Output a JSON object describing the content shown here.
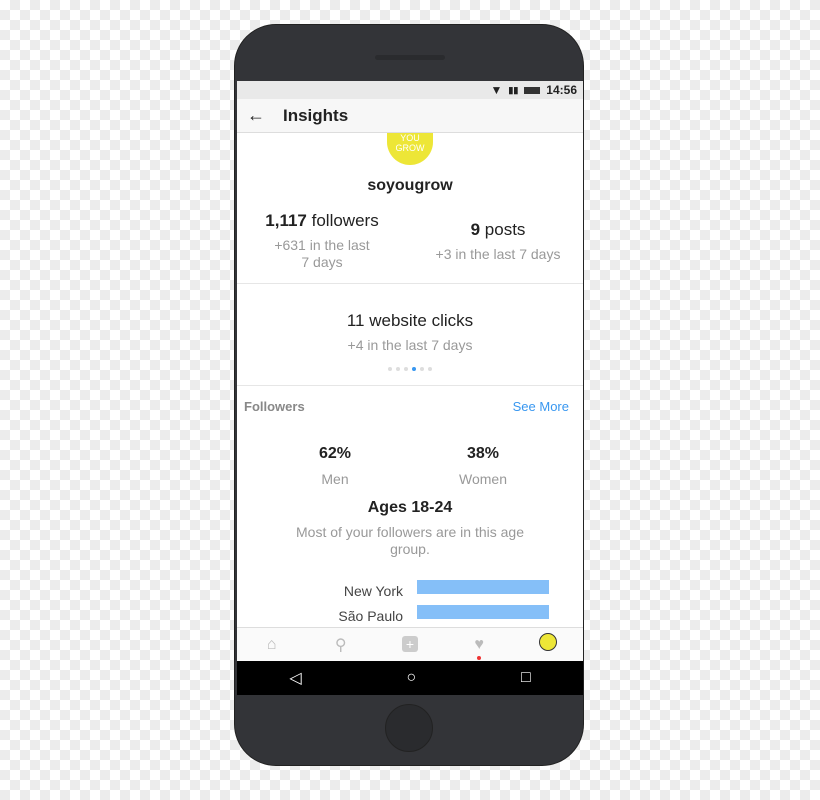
{
  "status": {
    "time": "14:56",
    "wifi_icon": "wifi-icon",
    "signal_icon": "signal-icon",
    "battery_icon": "battery-icon"
  },
  "appbar": {
    "back": "←",
    "title": "Insights"
  },
  "profile": {
    "avatar_text": "YOU GROW",
    "username": "soyougrow"
  },
  "stats": {
    "followers": {
      "value": "1,117",
      "label": "followers",
      "delta": "+631 in the last 7 days"
    },
    "posts": {
      "value": "9",
      "label": "posts",
      "delta": "+3 in the last 7 days"
    },
    "clicks": {
      "title": "11 website clicks",
      "delta": "+4 in the last 7 days"
    }
  },
  "carousel": {
    "count": 6,
    "active": 4
  },
  "followers_section": {
    "title": "Followers",
    "see_more": "See More",
    "men": {
      "pct": "62%",
      "label": "Men"
    },
    "women": {
      "pct": "38%",
      "label": "Women"
    },
    "ages": "Ages 18-24",
    "ages_sub": "Most of your followers are in this age group.",
    "cities": [
      {
        "name": "New York",
        "share": 1.0
      },
      {
        "name": "São Paulo",
        "share": 1.0
      }
    ]
  },
  "colors": {
    "accent": "#3897f0",
    "bar": "#85bff8",
    "avatar": "#ede637",
    "phone": "#333438"
  },
  "bottom_nav": [
    "home-icon",
    "search-icon",
    "add-icon",
    "heart-icon",
    "profile-icon"
  ],
  "android_nav": {
    "back": "◁",
    "home": "○",
    "recents": "□"
  }
}
